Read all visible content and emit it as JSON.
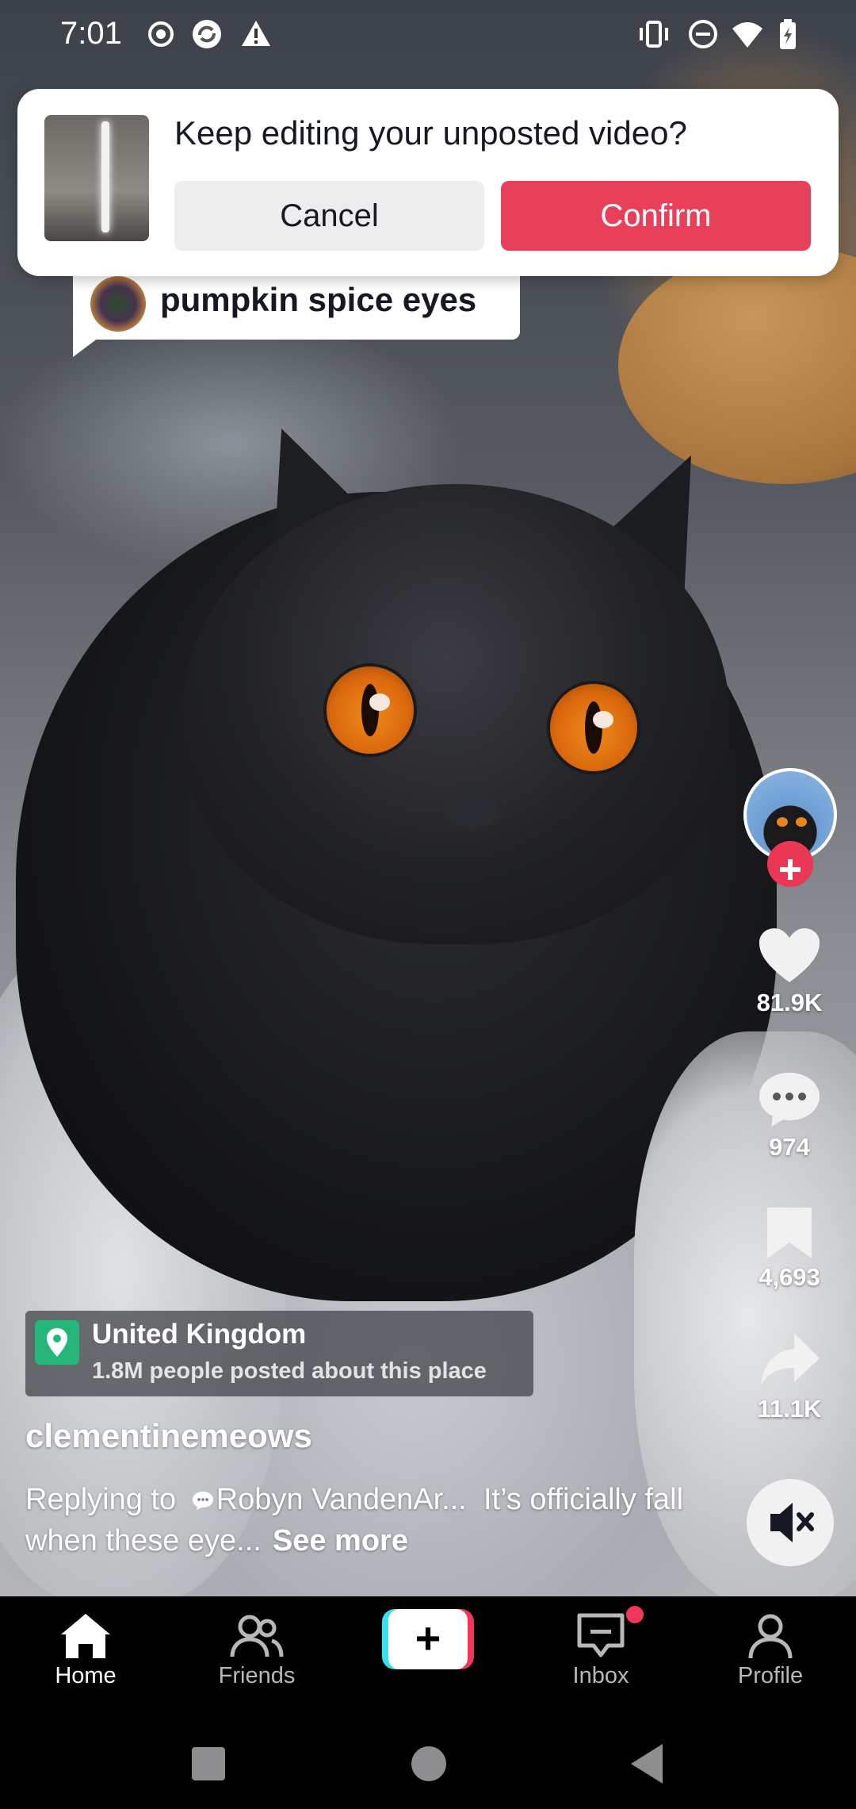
{
  "status_bar": {
    "time": "7:01",
    "icons": [
      "record-icon",
      "sync-icon",
      "warning-icon",
      "vibrate-icon",
      "do-not-disturb-icon",
      "wifi-icon",
      "battery-icon"
    ]
  },
  "draft_dialog": {
    "title": "Keep editing your unposted video?",
    "cancel_label": "Cancel",
    "confirm_label": "Confirm",
    "confirm_color": "#e8405a"
  },
  "sound_sticker": {
    "text": "pumpkin spice eyes"
  },
  "actions": {
    "likes": "81.9K",
    "comments": "974",
    "saves": "4,693",
    "shares": "11.1K",
    "follow_icon": "plus-icon",
    "mute_icon": "speaker-muted-icon"
  },
  "location": {
    "title": "United Kingdom",
    "subtitle": "1.8M people posted about this place",
    "icon_color": "#25b779"
  },
  "post": {
    "username": "clementinemeows",
    "caption_prefix": "Replying to",
    "mention": "Robyn VandenAr...",
    "caption_rest": "It’s officially fall when these eye...",
    "see_more": "See more"
  },
  "bottom_nav": {
    "home": "Home",
    "friends": "Friends",
    "create": "+",
    "inbox": "Inbox",
    "profile": "Profile",
    "accent_pink": "#f2365a",
    "accent_cyan": "#39e1ee"
  }
}
